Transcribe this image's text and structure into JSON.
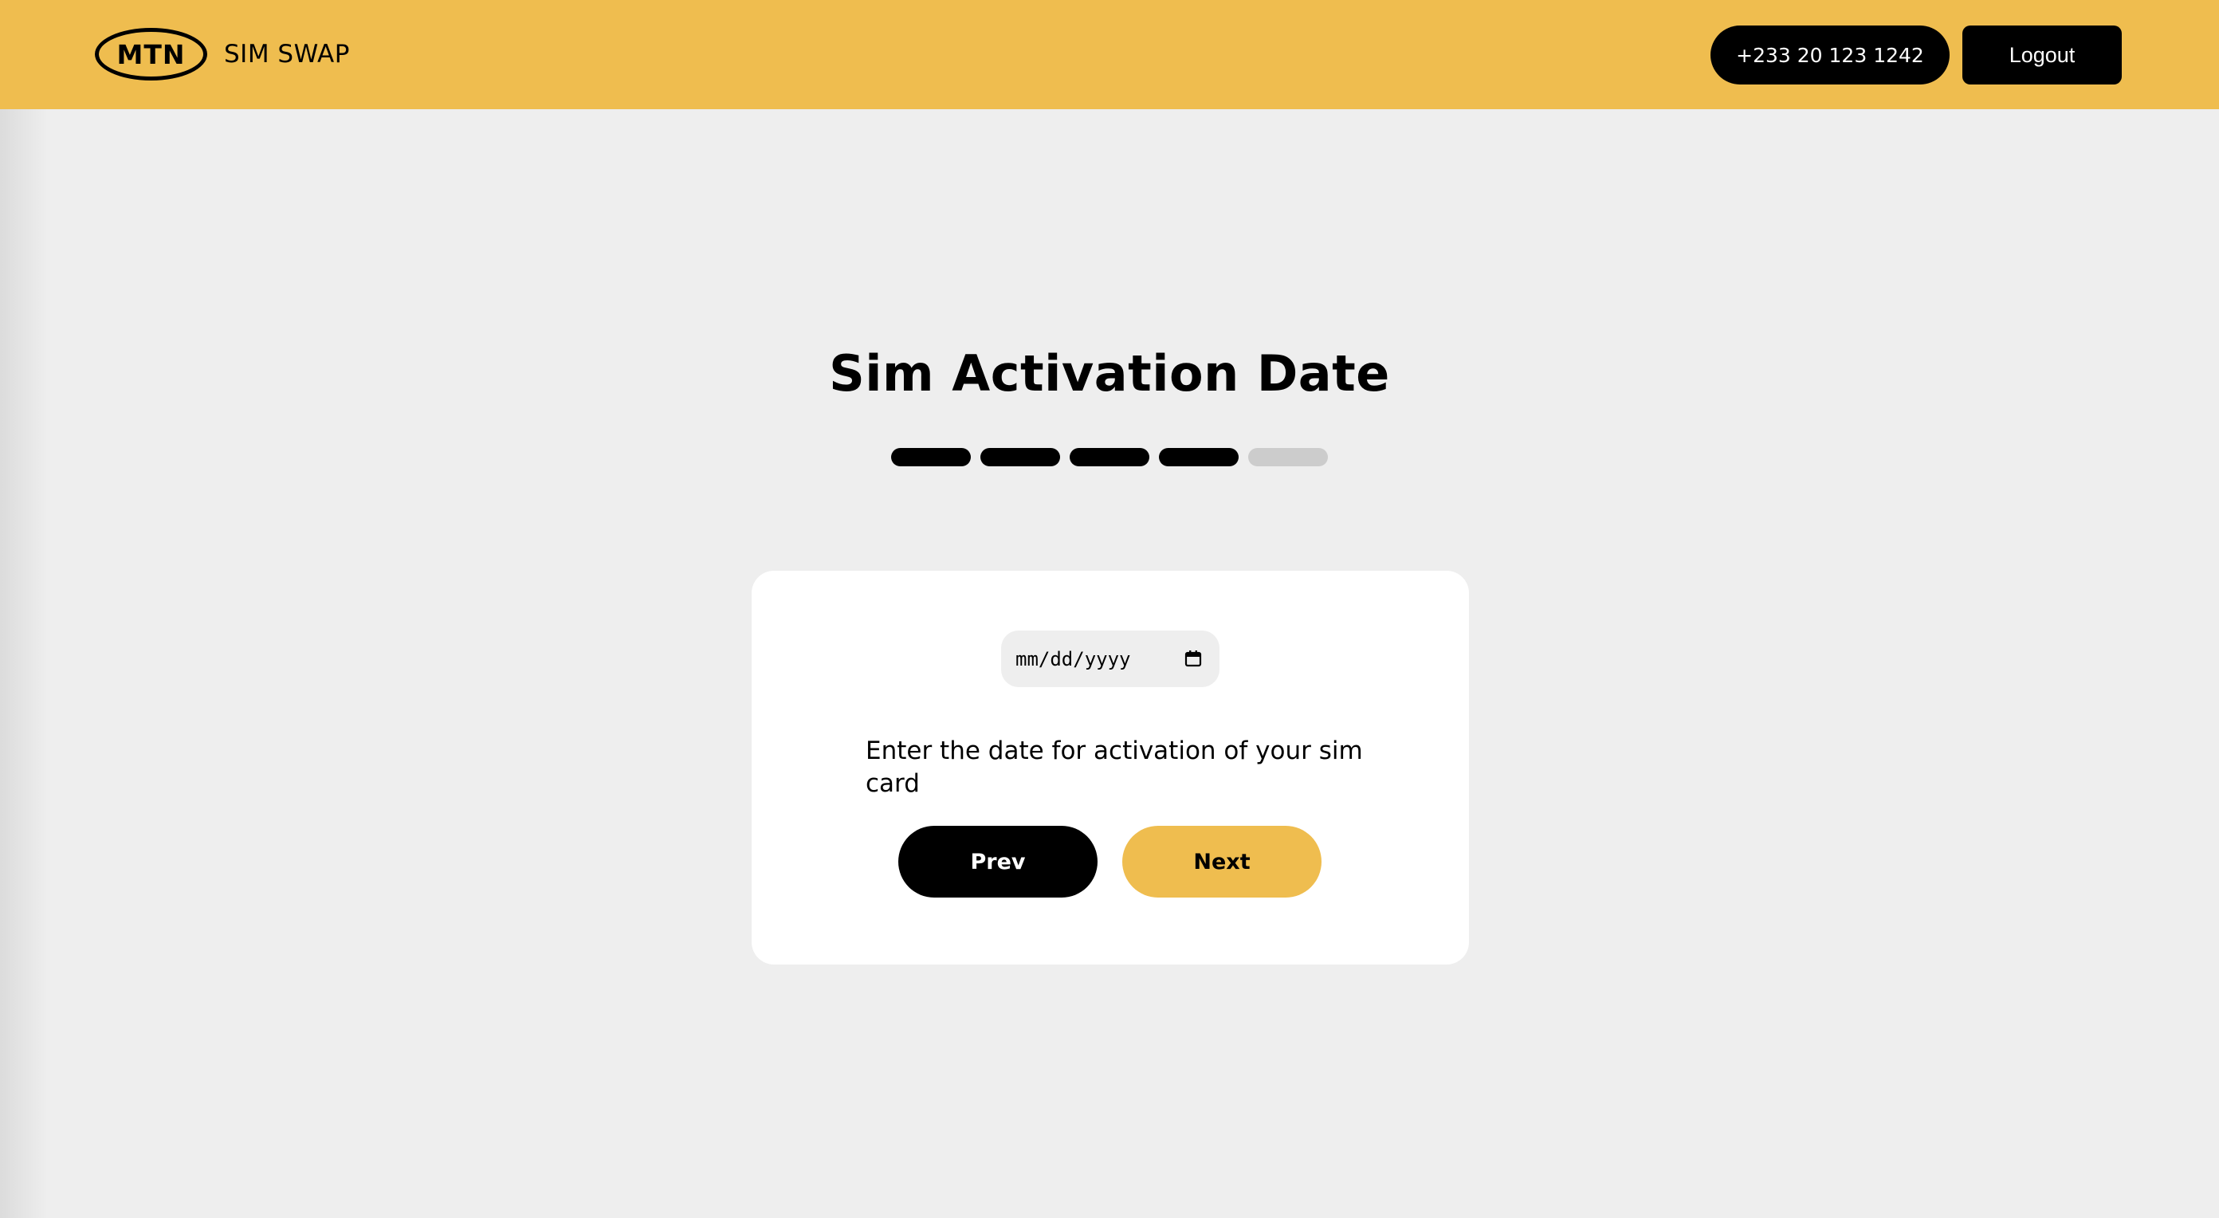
{
  "header": {
    "logo_text": "MTN",
    "app_name": "SIM SWAP",
    "phone_number": "+233 20 123 1242",
    "logout_label": "Logout"
  },
  "page": {
    "title": "Sim Activation Date"
  },
  "progress": {
    "total_steps": 5,
    "completed_steps": 4
  },
  "form": {
    "date_placeholder": "mm/dd/yyyy",
    "hint": "Enter the date for activation of your sim card",
    "prev_label": "Prev",
    "next_label": "Next"
  },
  "colors": {
    "brand_yellow": "#efbd4f",
    "background": "#eeeeee",
    "dark": "#000000",
    "inactive_step": "#cccccc"
  }
}
